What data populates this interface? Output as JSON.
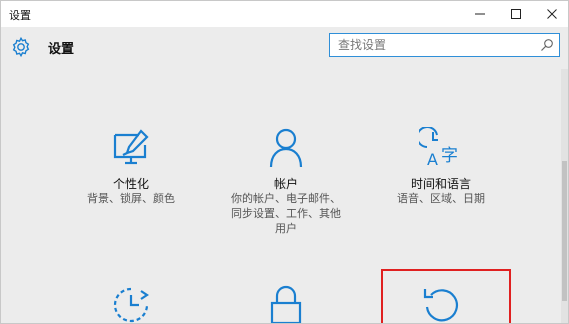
{
  "window": {
    "title": "设置"
  },
  "header": {
    "title": "设置",
    "icon": "gear-icon"
  },
  "search": {
    "placeholder": "查找设置",
    "value": ""
  },
  "colors": {
    "accent": "#1a7fd0",
    "highlight": "#e02020"
  },
  "tiles": [
    {
      "icon": "personalization-icon",
      "title": "个性化",
      "desc": [
        "背景、锁屏、颜色"
      ]
    },
    {
      "icon": "accounts-icon",
      "title": "帐户",
      "desc": [
        "你的帐户、电子邮件、",
        "同步设置、工作、其他",
        "用户"
      ]
    },
    {
      "icon": "time-language-icon",
      "title": "时间和语言",
      "desc": [
        "语音、区域、日期"
      ]
    },
    {
      "icon": "update-clock-icon",
      "title": "",
      "desc": []
    },
    {
      "icon": "lock-icon",
      "title": "",
      "desc": []
    },
    {
      "icon": "refresh-icon",
      "title": "",
      "desc": []
    }
  ]
}
